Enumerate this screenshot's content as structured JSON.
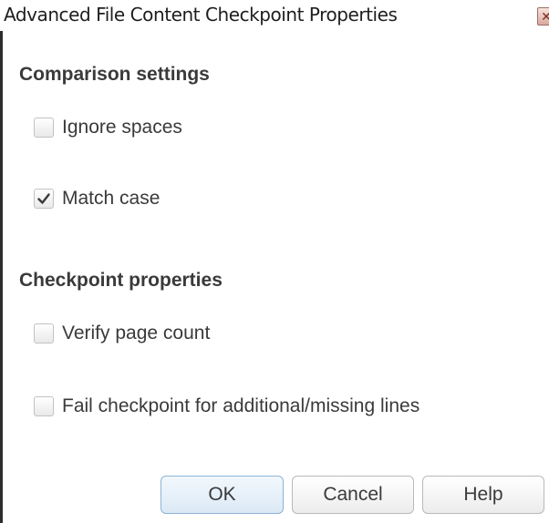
{
  "dialog": {
    "title": "Advanced File Content Checkpoint Properties",
    "close_icon": "close-icon"
  },
  "comparison_settings": {
    "header": "Comparison settings",
    "options": [
      {
        "label": "Ignore spaces",
        "checked": false
      },
      {
        "label": "Match case",
        "checked": true
      }
    ]
  },
  "checkpoint_properties": {
    "header": "Checkpoint properties",
    "options": [
      {
        "label": "Verify page count",
        "checked": false
      },
      {
        "label": "Fail checkpoint for additional/missing lines",
        "checked": false
      }
    ]
  },
  "buttons": {
    "ok": "OK",
    "cancel": "Cancel",
    "help": "Help"
  },
  "colors": {
    "accent": "#8db3d3",
    "text": "#3a3a3a"
  }
}
